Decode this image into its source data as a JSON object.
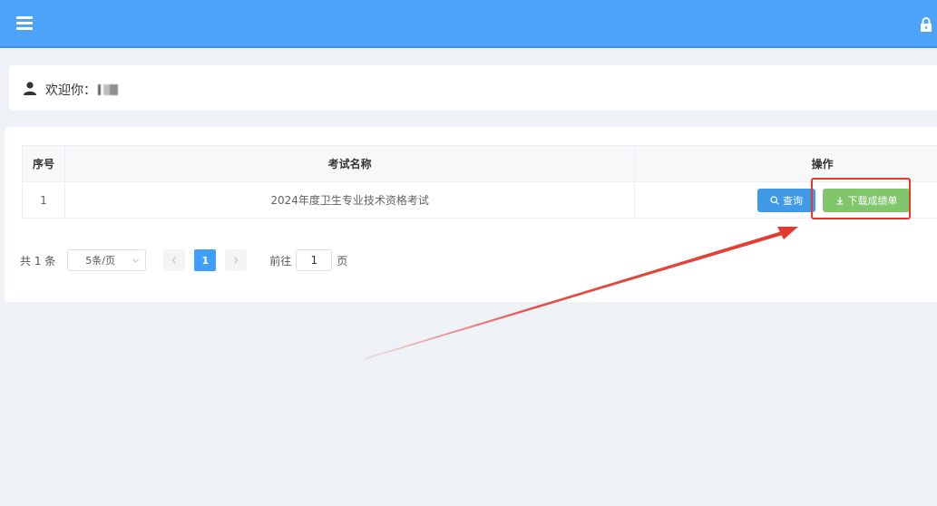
{
  "header": {
    "menu_icon": "hamburger-icon",
    "lock_icon": "lock-icon",
    "bg_color": "#4da3f8"
  },
  "welcome": {
    "icon": "user-icon",
    "text": "欢迎你："
  },
  "table": {
    "columns": [
      "序号",
      "考试名称",
      "操作"
    ],
    "rows": [
      {
        "index": "1",
        "name": "2024年度卫生专业技术资格考试"
      }
    ],
    "actions": {
      "query_label": "查询",
      "query_icon": "search-icon",
      "download_label": "下载成绩单",
      "download_icon": "download-icon"
    }
  },
  "pagination": {
    "total": "共 1 条",
    "page_size": "5条/页",
    "current_page": "1",
    "goto_prefix": "前往",
    "goto_value": "1",
    "goto_suffix": "页"
  },
  "annotation": {
    "color": "#e23a2e"
  }
}
